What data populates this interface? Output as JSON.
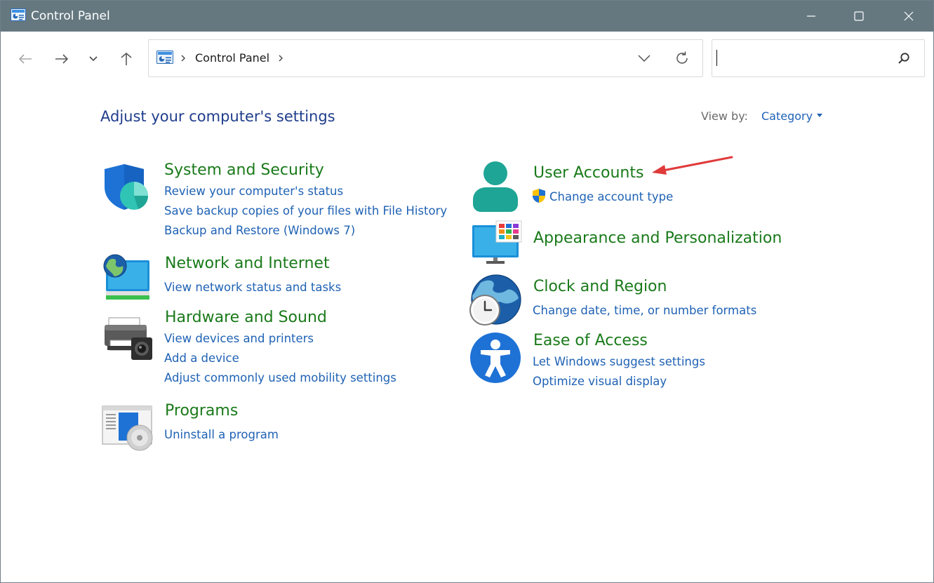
{
  "window": {
    "title": "Control Panel"
  },
  "address": {
    "crumb": "Control Panel"
  },
  "search": {
    "value": ""
  },
  "main": {
    "heading": "Adjust your computer's settings",
    "view_by_label": "View by:",
    "view_by_value": "Category"
  },
  "categories": [
    {
      "title": "System and Security",
      "icon": "shield-icon",
      "links": [
        "Review your computer's status",
        "Save backup copies of your files with File History",
        "Backup and Restore (Windows 7)"
      ]
    },
    {
      "title": "Network and Internet",
      "icon": "network-globe-icon",
      "links": [
        "View network status and tasks"
      ]
    },
    {
      "title": "Hardware and Sound",
      "icon": "printer-icon",
      "links": [
        "View devices and printers",
        "Add a device",
        "Adjust commonly used mobility settings"
      ]
    },
    {
      "title": "Programs",
      "icon": "programs-icon",
      "links": [
        "Uninstall a program"
      ]
    },
    {
      "title": "User Accounts",
      "icon": "user-icon",
      "links": [
        "Change account type"
      ]
    },
    {
      "title": "Appearance and Personalization",
      "icon": "monitor-icon",
      "links": []
    },
    {
      "title": "Clock and Region",
      "icon": "clock-globe-icon",
      "links": [
        "Change date, time, or number formats"
      ]
    },
    {
      "title": "Ease of Access",
      "icon": "accessibility-icon",
      "links": [
        "Let Windows suggest settings",
        "Optimize visual display"
      ]
    }
  ],
  "colors": {
    "titlebar": "#657880",
    "heading": "#1f3d8c",
    "category_title": "#1a7a1a",
    "link": "#1f62b4",
    "annotation_arrow": "#e03a3a"
  }
}
